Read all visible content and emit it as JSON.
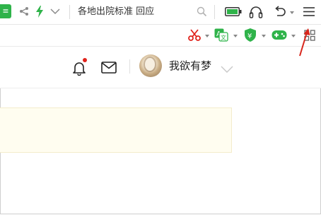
{
  "browser": {
    "page_title": "各地出院标准 回应",
    "brand_green": "#2fb34a",
    "accent_red": "#e0221b"
  },
  "toolbar_icons": [
    "share-icon",
    "lightning-icon",
    "chevron-down-icon",
    "search-icon",
    "battery-icon",
    "headphones-icon",
    "undo-icon",
    "menu-icon"
  ],
  "toolbar2_icons": [
    "scissors-icon",
    "translate-icon",
    "shield-yuan-icon",
    "gamepad-icon",
    "apps-grid-icon"
  ],
  "header": {
    "username": "我欲有梦"
  }
}
